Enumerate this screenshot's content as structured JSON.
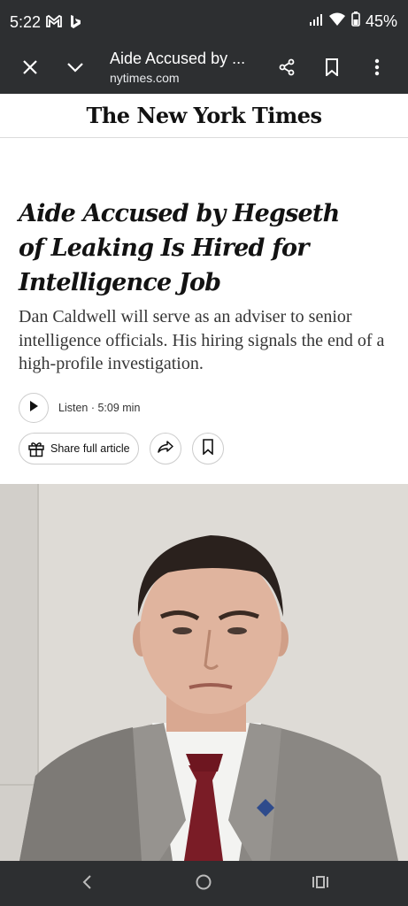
{
  "status_bar": {
    "time": "5:22",
    "battery": "45%",
    "icons": [
      "gmail-icon",
      "bing-icon",
      "signal-icon",
      "wifi-icon",
      "battery-icon"
    ]
  },
  "toolbar": {
    "title": "Aide Accused by ...",
    "url": "nytimes.com",
    "icons": [
      "close-icon",
      "chevron-down-icon",
      "share-icon",
      "bookmark-icon",
      "more-vert-icon"
    ]
  },
  "masthead": {
    "logo": "The New York Times"
  },
  "article": {
    "headline_lines": [
      "Aide Accused by Hegseth",
      "of Leaking Is Hired for",
      "Intelligence Job"
    ],
    "summary": "Dan Caldwell will serve as an adviser to senior intelligence officials. His hiring signals the end of a high-profile investigation.",
    "listen_label": "Listen · 5:09 min",
    "share_label": "Share full article"
  },
  "colors": {
    "chrome_bg": "#2d2f31",
    "text": "#121212",
    "summary_text": "#363636",
    "border": "#cccccc"
  }
}
